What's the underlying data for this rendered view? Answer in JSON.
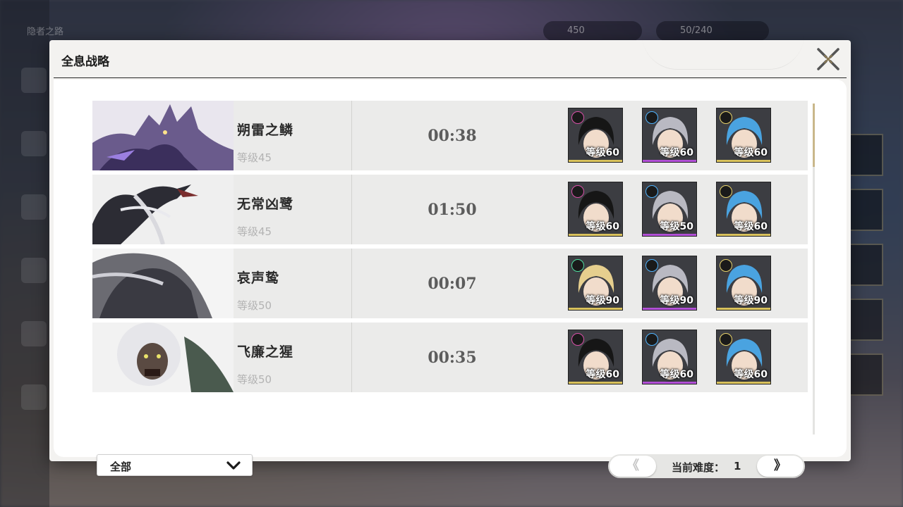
{
  "background": {
    "top_title": "隐者之路",
    "currency_a": "450",
    "currency_b": "50/240"
  },
  "dialog": {
    "title": "全息战略",
    "close_icon": "close-x-icon"
  },
  "bosses": [
    {
      "name": "朔雷之鳞",
      "level": "等级45",
      "time": "00:38",
      "art_palette": "purple-thunder",
      "team": [
        {
          "element": "havoc",
          "level": "等级60",
          "bar": "#d9c25c",
          "hair": "black"
        },
        {
          "element": "glacio",
          "level": "等级60",
          "bar": "#b14fd6",
          "hair": "silver"
        },
        {
          "element": "spectro",
          "level": "等级60",
          "bar": "#d9c25c",
          "hair": "blue"
        }
      ]
    },
    {
      "name": "无常凶鹭",
      "level": "等级45",
      "time": "01:50",
      "art_palette": "dark-heron",
      "team": [
        {
          "element": "havoc",
          "level": "等级60",
          "bar": "#d9c25c",
          "hair": "black"
        },
        {
          "element": "glacio",
          "level": "等级50",
          "bar": "#b14fd6",
          "hair": "silver"
        },
        {
          "element": "spectro",
          "level": "等级60",
          "bar": "#d9c25c",
          "hair": "blue"
        }
      ]
    },
    {
      "name": "哀声鸷",
      "level": "等级50",
      "time": "00:07",
      "art_palette": "grey-raptor",
      "team": [
        {
          "element": "aero",
          "level": "等级90",
          "bar": "#d9c25c",
          "hair": "blonde"
        },
        {
          "element": "glacio",
          "level": "等级90",
          "bar": "#b14fd6",
          "hair": "silver"
        },
        {
          "element": "spectro",
          "level": "等级90",
          "bar": "#d9c25c",
          "hair": "blue"
        }
      ]
    },
    {
      "name": "飞廉之猩",
      "level": "等级50",
      "time": "00:35",
      "art_palette": "white-ape",
      "team": [
        {
          "element": "havoc",
          "level": "等级60",
          "bar": "#d9c25c",
          "hair": "black"
        },
        {
          "element": "glacio",
          "level": "等级60",
          "bar": "#b14fd6",
          "hair": "silver"
        },
        {
          "element": "spectro",
          "level": "等级60",
          "bar": "#d9c25c",
          "hair": "blue"
        }
      ]
    }
  ],
  "filter": {
    "selected": "全部",
    "icon": "chevron-down-icon"
  },
  "pager": {
    "label": "当前难度：",
    "value": "1",
    "prev_glyph": "《",
    "next_glyph": "》"
  },
  "colors": {
    "accent": "#c9b78a",
    "row_bg": "#ebebea",
    "panel_bg": "#ffffff"
  }
}
